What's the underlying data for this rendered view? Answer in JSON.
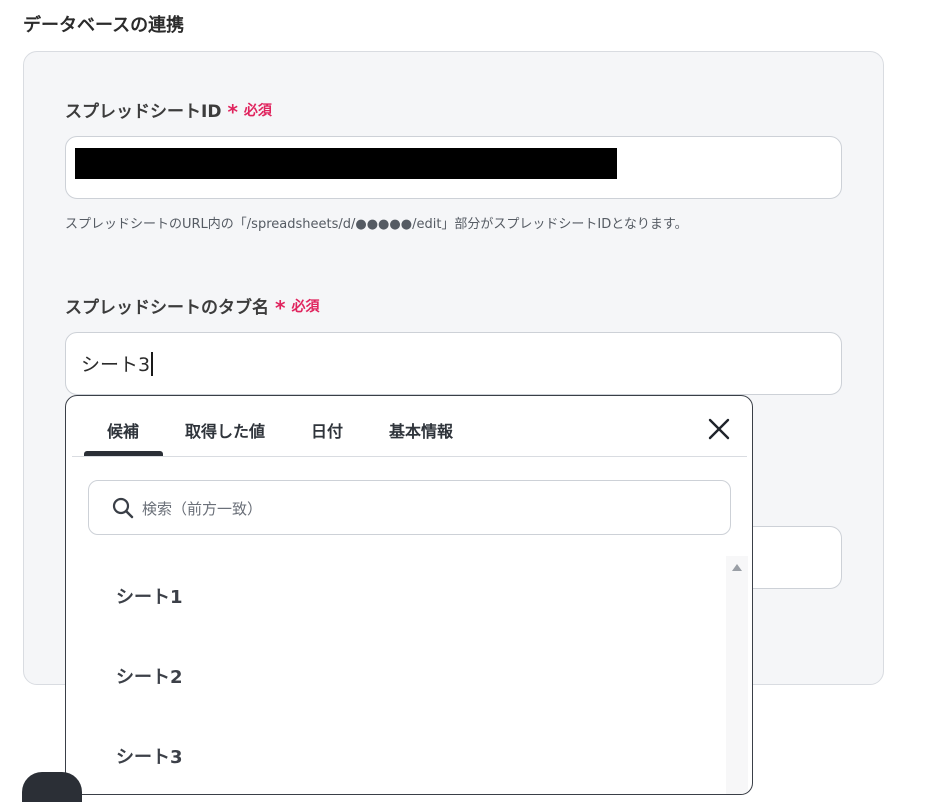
{
  "section": {
    "title": "データベースの連携"
  },
  "fields": {
    "spreadsheet_id": {
      "label": "スプレッドシートID",
      "required_mark": "*",
      "required_text": "必須",
      "help": "スプレッドシートのURL内の「/spreadsheets/d/●●●●●/edit」部分がスプレッドシートIDとなります。"
    },
    "tab_name": {
      "label": "スプレッドシートのタブ名",
      "required_mark": "*",
      "required_text": "必須",
      "value": "シート3"
    }
  },
  "dropdown": {
    "tabs": [
      {
        "label": "候補",
        "active": true
      },
      {
        "label": "取得した値",
        "active": false
      },
      {
        "label": "日付",
        "active": false
      },
      {
        "label": "基本情報",
        "active": false
      }
    ],
    "search_placeholder": "検索（前方一致）",
    "options": [
      "シート1",
      "シート2",
      "シート3"
    ]
  },
  "colors": {
    "required": "#e0245e",
    "panel_bg": "#f5f6f8",
    "active_tab_underline": "#2b2f36"
  },
  "icons": {
    "close": "close-icon",
    "search": "search-icon",
    "scroll_up": "scroll-up-arrow-icon"
  }
}
